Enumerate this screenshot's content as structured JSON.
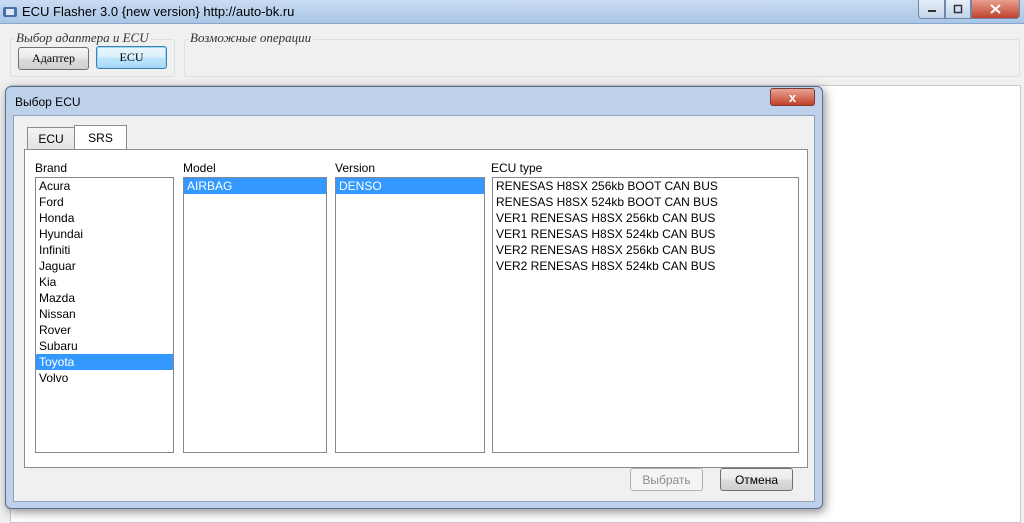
{
  "main_window": {
    "title": "ECU Flasher 3.0 {new version} http://auto-bk.ru",
    "adapter_group_label": "Выбор адаптера и ECU",
    "adapter_button": "Адаптер",
    "ecu_button": "ECU",
    "operations_group_label": "Возможные операции"
  },
  "dialog": {
    "title": "Выбор ECU",
    "close_glyph": "x",
    "tabs": [
      {
        "label": "ECU"
      },
      {
        "label": "SRS"
      }
    ],
    "active_tab": "SRS",
    "brand": {
      "label": "Brand",
      "items": [
        "Acura",
        "Ford",
        "Honda",
        "Hyundai",
        "Infiniti",
        "Jaguar",
        "Kia",
        "Mazda",
        "Nissan",
        "Rover",
        "Subaru",
        "Toyota",
        "Volvo"
      ],
      "selected": "Toyota"
    },
    "model": {
      "label": "Model",
      "items": [
        "AIRBAG"
      ],
      "selected": "AIRBAG"
    },
    "version": {
      "label": "Version",
      "items": [
        "DENSO"
      ],
      "selected": "DENSO"
    },
    "ecu_type": {
      "label": "ECU type",
      "items": [
        "RENESAS H8SX 256kb BOOT CAN BUS",
        "RENESAS H8SX 524kb BOOT CAN BUS",
        "VER1 RENESAS H8SX 256kb CAN BUS",
        "VER1 RENESAS H8SX 524kb CAN BUS",
        "VER2 RENESAS H8SX 256kb CAN BUS",
        "VER2 RENESAS H8SX 524kb CAN BUS"
      ]
    },
    "select_button": "Выбрать",
    "cancel_button": "Отмена"
  },
  "icons": {
    "app": "app-icon",
    "minimize": "minimize-icon",
    "maximize": "maximize-icon",
    "close": "close-icon"
  }
}
